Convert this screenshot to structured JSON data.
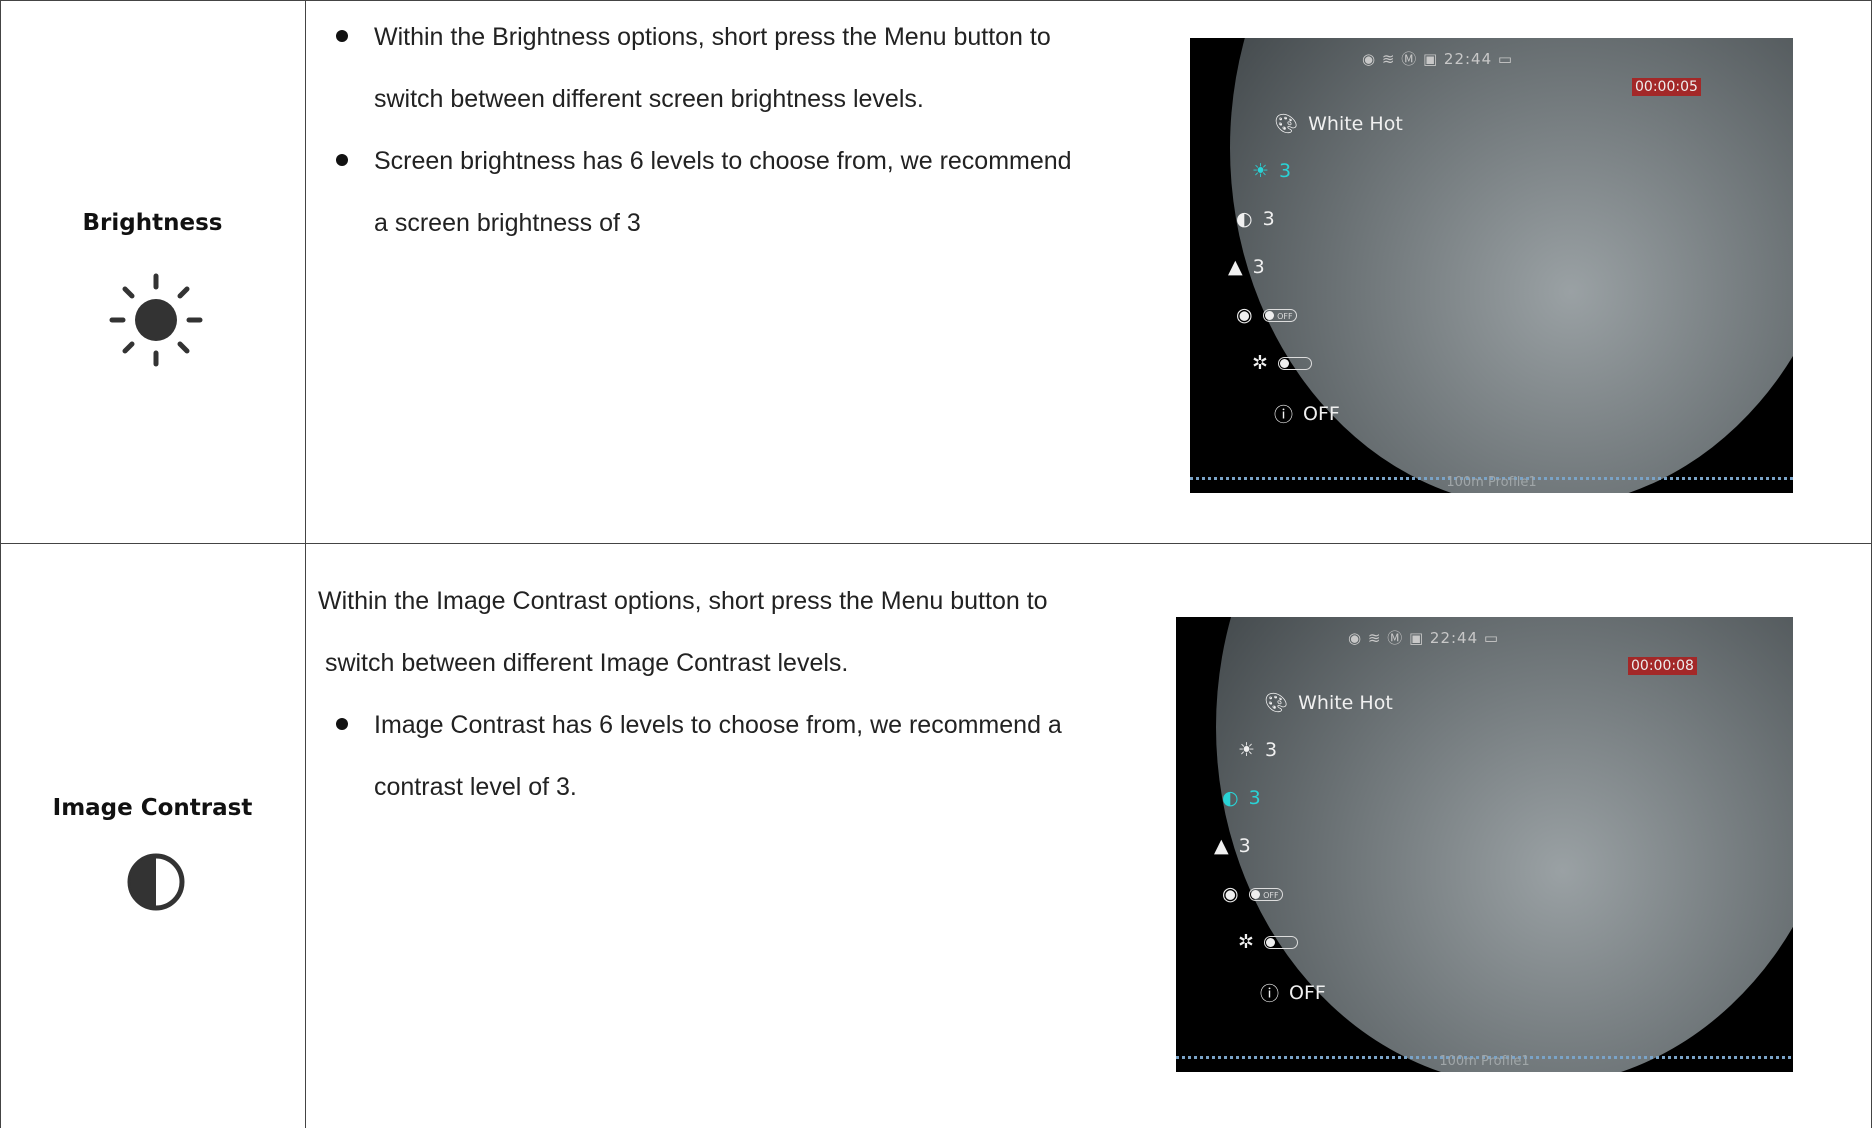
{
  "rows": [
    {
      "label": "Brightness",
      "icon": "sun-icon",
      "paragraphs": [
        {
          "bullet": true,
          "lines": [
            "Within the Brightness options, short press the Menu button to",
            "switch between different screen brightness levels."
          ]
        },
        {
          "bullet": true,
          "lines": [
            "Screen brightness has 6 levels to choose from, we recommend",
            "a screen brightness of 3"
          ]
        }
      ],
      "screen": {
        "time": "22:44",
        "timer": "00:00:05",
        "palette": "White Hot",
        "brightness": "3",
        "contrast": "3",
        "sharpness": "3",
        "toggle1": "OFF",
        "toggle2": "",
        "last": "OFF",
        "bottom": "100m  Profile1",
        "active": "brightness"
      }
    },
    {
      "label": "Image Contrast",
      "icon": "contrast-icon",
      "paragraphs": [
        {
          "bullet": false,
          "lines": [
            "Within the Image Contrast options, short press the Menu button to",
            " switch between different Image Contrast levels."
          ]
        },
        {
          "bullet": true,
          "lines": [
            "Image Contrast has 6 levels to choose from, we recommend a",
            "contrast level of 3."
          ]
        }
      ],
      "screen": {
        "time": "22:44",
        "timer": "00:00:08",
        "palette": "White Hot",
        "brightness": "3",
        "contrast": "3",
        "sharpness": "3",
        "toggle1": "OFF",
        "toggle2": "",
        "last": "OFF",
        "bottom": "100m  Profile1",
        "active": "contrast"
      }
    }
  ],
  "colors": {
    "active": "#29d3d6",
    "rec": "#a32828",
    "border": "#444444"
  }
}
